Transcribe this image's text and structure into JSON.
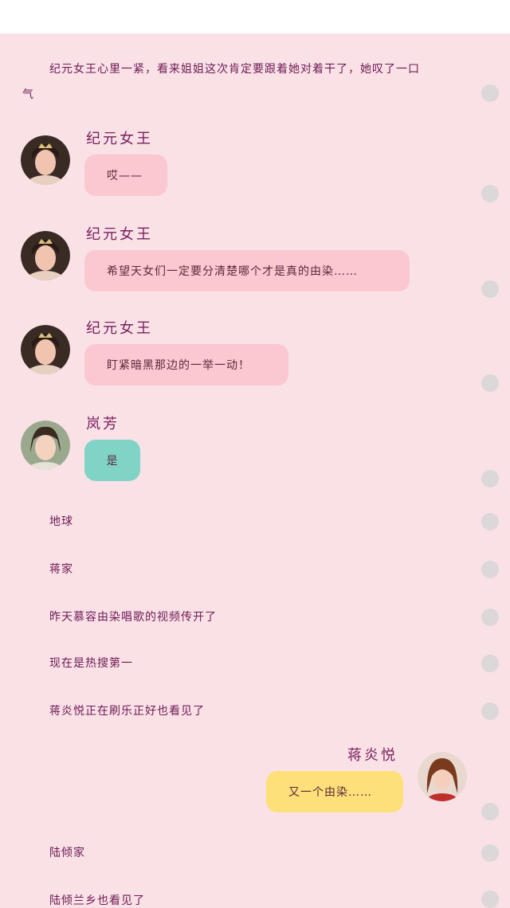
{
  "narration": {
    "line1": "纪元女王心里一紧，看来姐姐这次肯定要跟着她对着干了，她叹了一口",
    "line1_cont": "气"
  },
  "messages": [
    {
      "name": "纪元女王",
      "text": "哎——"
    },
    {
      "name": "纪元女王",
      "text": "希望天女们一定要分清楚哪个才是真的由染……"
    },
    {
      "name": "纪元女王",
      "text": "盯紧暗黑那边的一举一动！"
    },
    {
      "name": "岚芳",
      "text": "是"
    }
  ],
  "lines": [
    "地球",
    "蒋家",
    "昨天慕容由染唱歌的视频传开了",
    "现在是热搜第一",
    "蒋炎悦正在刷乐正好也看见了"
  ],
  "right_message": {
    "name": "蒋炎悦",
    "text": "又一个由染……"
  },
  "lines2": [
    "陆倾家",
    "陆倾兰乡也看见了"
  ],
  "colors": {
    "background": "#f9e1e6",
    "bubble_pink": "#fbc7d1",
    "bubble_teal": "#7fd4c6",
    "bubble_yellow": "#fde07a",
    "name_color": "#7a1e5e"
  }
}
